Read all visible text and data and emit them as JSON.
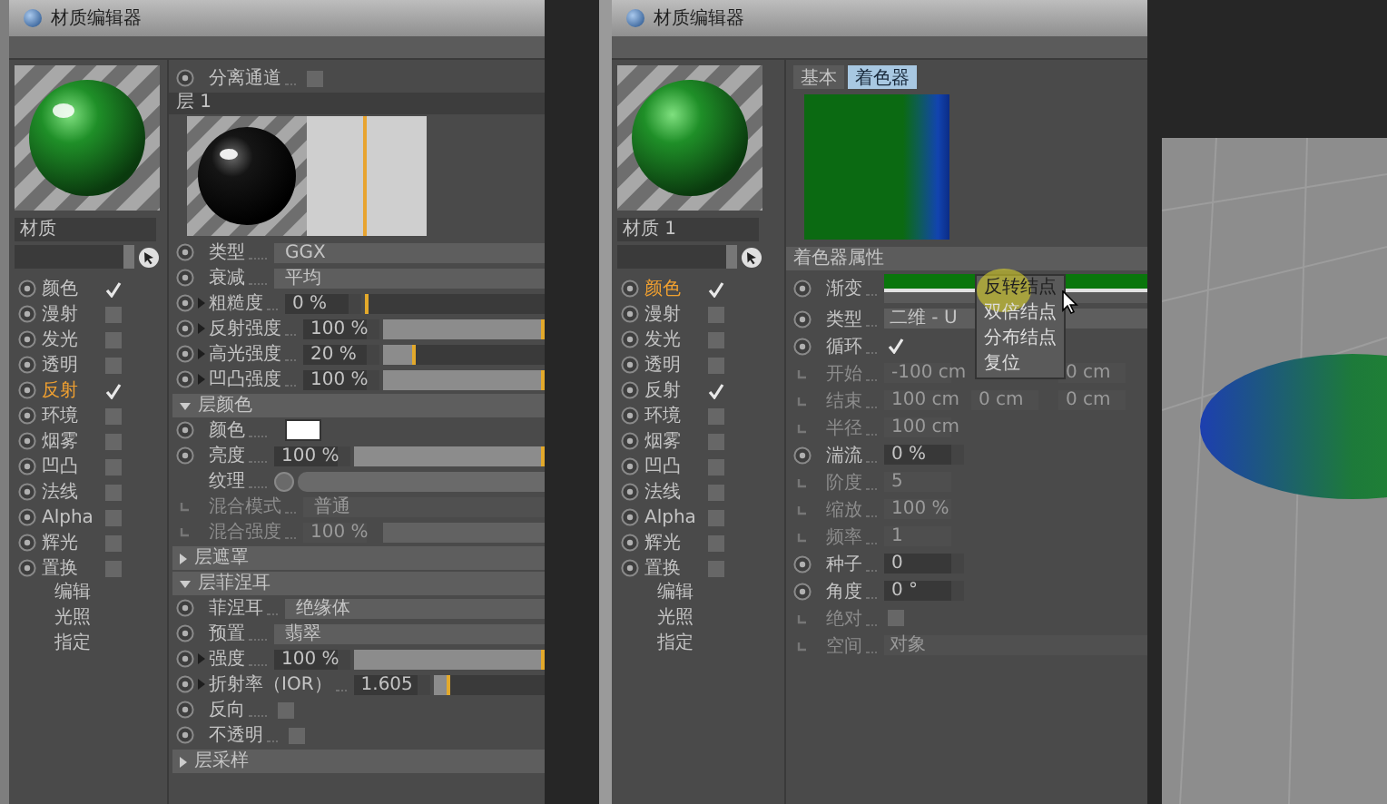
{
  "windows": [
    {
      "title": "材质编辑器",
      "material_name": "材质",
      "channels": [
        {
          "label": "颜色",
          "checked": true,
          "selected": false
        },
        {
          "label": "漫射",
          "checked": false,
          "selected": false
        },
        {
          "label": "发光",
          "checked": false,
          "selected": false
        },
        {
          "label": "透明",
          "checked": false,
          "selected": false
        },
        {
          "label": "反射",
          "checked": true,
          "selected": true
        },
        {
          "label": "环境",
          "checked": false,
          "selected": false
        },
        {
          "label": "烟雾",
          "checked": false,
          "selected": false
        },
        {
          "label": "凹凸",
          "checked": false,
          "selected": false
        },
        {
          "label": "法线",
          "checked": false,
          "selected": false
        },
        {
          "label": "Alpha",
          "checked": false,
          "selected": false
        },
        {
          "label": "辉光",
          "checked": false,
          "selected": false
        },
        {
          "label": "置换",
          "checked": false,
          "selected": false
        }
      ],
      "pages": [
        {
          "label": "编辑",
          "selected": false
        },
        {
          "label": "光照",
          "selected": false
        },
        {
          "label": "指定",
          "selected": false
        }
      ],
      "properties": [
        {
          "kind": "checkbox",
          "label": "分离通道",
          "checked": false,
          "disabled": false
        },
        {
          "kind": "header",
          "label": "层 1"
        },
        {
          "kind": "layer_preview"
        },
        {
          "kind": "dropdown",
          "label": "类型",
          "value": "GGX",
          "disabled": false
        },
        {
          "kind": "dropdown",
          "label": "衰减",
          "value": "平均",
          "disabled": false
        },
        {
          "kind": "slider",
          "label": "粗糙度",
          "value": "0 %",
          "level": 0,
          "expandable": true,
          "disabled": false
        },
        {
          "kind": "slider",
          "label": "反射强度",
          "value": "100 %",
          "level": 1,
          "expandable": true,
          "disabled": false
        },
        {
          "kind": "slider",
          "label": "高光强度",
          "value": "20 %",
          "level": 0.2,
          "expandable": true,
          "disabled": false
        },
        {
          "kind": "slider",
          "label": "凹凸强度",
          "value": "100 %",
          "level": 1,
          "expandable": true,
          "disabled": false
        },
        {
          "kind": "section",
          "label": "层颜色",
          "expanded": true
        },
        {
          "kind": "swatch",
          "label": "颜色",
          "disabled": false
        },
        {
          "kind": "slider",
          "label": "亮度",
          "value": "100 %",
          "level": 1,
          "expandable": false,
          "disabled": false
        },
        {
          "kind": "texture",
          "label": "纹理"
        },
        {
          "kind": "dropdown",
          "label": "混合模式",
          "value": "普通",
          "disabled": true
        },
        {
          "kind": "slider",
          "label": "混合强度",
          "value": "100 %",
          "level": 1,
          "expandable": false,
          "disabled": true
        },
        {
          "kind": "section",
          "label": "层遮罩",
          "expanded": false
        },
        {
          "kind": "section",
          "label": "层菲涅耳",
          "expanded": true
        },
        {
          "kind": "dropdown",
          "label": "菲涅耳",
          "value": "绝缘体",
          "disabled": false
        },
        {
          "kind": "dropdown",
          "label": "预置",
          "value": "翡翠",
          "disabled": false
        },
        {
          "kind": "slider",
          "label": "强度",
          "value": "100 %",
          "level": 1,
          "expandable": true,
          "disabled": false
        },
        {
          "kind": "slider",
          "label": "折射率（IOR）",
          "value": "1.605",
          "level": 0.15,
          "expandable": true,
          "disabled": false
        },
        {
          "kind": "checkbox",
          "label": "反向",
          "checked": false,
          "disabled": false
        },
        {
          "kind": "checkbox",
          "label": "不透明",
          "checked": false,
          "disabled": false
        },
        {
          "kind": "section",
          "label": "层采样",
          "expanded": false
        }
      ]
    },
    {
      "title": "材质编辑器",
      "material_name": "材质 1",
      "channels": [
        {
          "label": "颜色",
          "checked": true,
          "selected": true
        },
        {
          "label": "漫射",
          "checked": false,
          "selected": false
        },
        {
          "label": "发光",
          "checked": false,
          "selected": false
        },
        {
          "label": "透明",
          "checked": false,
          "selected": false
        },
        {
          "label": "反射",
          "checked": true,
          "selected": false
        },
        {
          "label": "环境",
          "checked": false,
          "selected": false
        },
        {
          "label": "烟雾",
          "checked": false,
          "selected": false
        },
        {
          "label": "凹凸",
          "checked": false,
          "selected": false
        },
        {
          "label": "法线",
          "checked": false,
          "selected": false
        },
        {
          "label": "Alpha",
          "checked": false,
          "selected": false
        },
        {
          "label": "辉光",
          "checked": false,
          "selected": false
        },
        {
          "label": "置换",
          "checked": false,
          "selected": false
        }
      ],
      "pages": [
        {
          "label": "编辑",
          "selected": false
        },
        {
          "label": "光照",
          "selected": false
        },
        {
          "label": "指定",
          "selected": false
        }
      ],
      "tabs": [
        {
          "label": "基本",
          "selected": false
        },
        {
          "label": "着色器",
          "selected": true
        }
      ],
      "properties": [
        {
          "kind": "shader_preview"
        },
        {
          "kind": "header",
          "label": "着色器属性"
        },
        {
          "kind": "gradient",
          "label": "渐变",
          "disabled": false,
          "menu": [
            {
              "label": "反转结点",
              "selected": true
            },
            {
              "label": "双倍结点",
              "selected": false
            },
            {
              "label": "分布结点",
              "selected": false
            },
            {
              "label": "复位",
              "selected": false
            }
          ]
        },
        {
          "kind": "dropdown",
          "label": "类型",
          "value": "二维 - U",
          "disabled": false
        },
        {
          "kind": "checkbox",
          "label": "循环",
          "checked": true,
          "disabled": false
        },
        {
          "kind": "triple",
          "label": "开始",
          "values": [
            "-100 cm",
            "0 cm"
          ],
          "disabled": true
        },
        {
          "kind": "triple",
          "label": "结束",
          "values": [
            "100 cm",
            "0 cm",
            "0 cm"
          ],
          "disabled": true
        },
        {
          "kind": "number",
          "label": "半径",
          "value": "100 cm",
          "disabled": true
        },
        {
          "kind": "number",
          "label": "湍流",
          "value": "0 %",
          "disabled": false
        },
        {
          "kind": "number",
          "label": "阶度",
          "value": "5",
          "disabled": true
        },
        {
          "kind": "number",
          "label": "缩放",
          "value": "100 %",
          "disabled": true
        },
        {
          "kind": "number",
          "label": "频率",
          "value": "1",
          "disabled": true
        },
        {
          "kind": "number",
          "label": "种子",
          "value": "0",
          "disabled": false
        },
        {
          "kind": "number",
          "label": "角度",
          "value": "0 °",
          "disabled": false
        },
        {
          "kind": "checkbox",
          "label": "绝对",
          "checked": false,
          "disabled": true
        },
        {
          "kind": "dropdown",
          "label": "空间",
          "value": "对象",
          "disabled": true
        }
      ]
    }
  ]
}
